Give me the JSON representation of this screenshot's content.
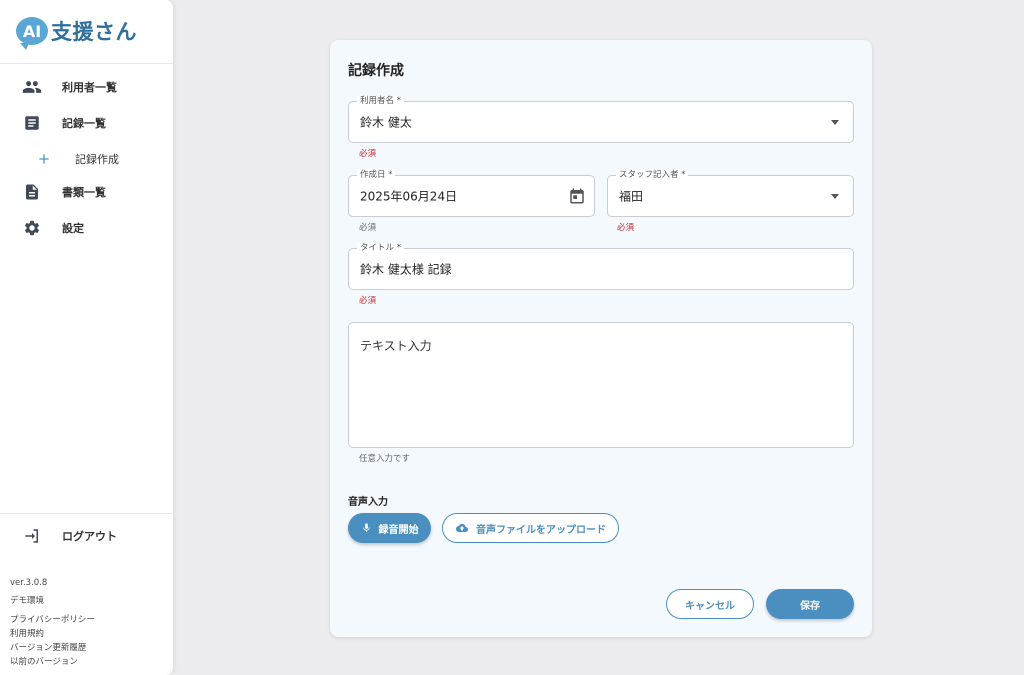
{
  "app": {
    "logo_badge": "AI",
    "logo_text": "支援さん"
  },
  "sidebar": {
    "items": [
      {
        "label": "利用者一覧",
        "icon": "people-icon"
      },
      {
        "label": "記録一覧",
        "icon": "list-icon"
      },
      {
        "label": "記録作成",
        "icon": "plus-icon"
      },
      {
        "label": "書類一覧",
        "icon": "document-icon"
      },
      {
        "label": "設定",
        "icon": "gear-icon"
      }
    ],
    "logout": {
      "label": "ログアウト",
      "icon": "logout-icon"
    },
    "footer": {
      "version": "ver.3.0.8",
      "environment": "デモ環境",
      "links": [
        "プライバシーポリシー",
        "利用規約",
        "バージョン更新履歴",
        "以前のバージョン"
      ]
    }
  },
  "form": {
    "title": "記録作成",
    "user_name": {
      "label": "利用者名 *",
      "value": "鈴木 健太",
      "helper": "必須"
    },
    "created_date": {
      "label": "作成日 *",
      "value": "2025年06月24日",
      "helper": "必須"
    },
    "staff": {
      "label": "スタッフ記入者 *",
      "value": "福田",
      "helper": "必須"
    },
    "record_title": {
      "label": "タイトル *",
      "value": "鈴木 健太様 記録",
      "helper": "必須"
    },
    "text_input": {
      "placeholder": "テキスト入力",
      "helper": "任意入力です"
    },
    "voice": {
      "section_label": "音声入力",
      "record_button": "録音開始",
      "upload_button": "音声ファイルをアップロード"
    },
    "cancel_button": "キャンセル",
    "save_button": "保存"
  },
  "colors": {
    "accent": "#4a8fbf",
    "required": "#c62828",
    "logo": "#5aa7d6"
  }
}
